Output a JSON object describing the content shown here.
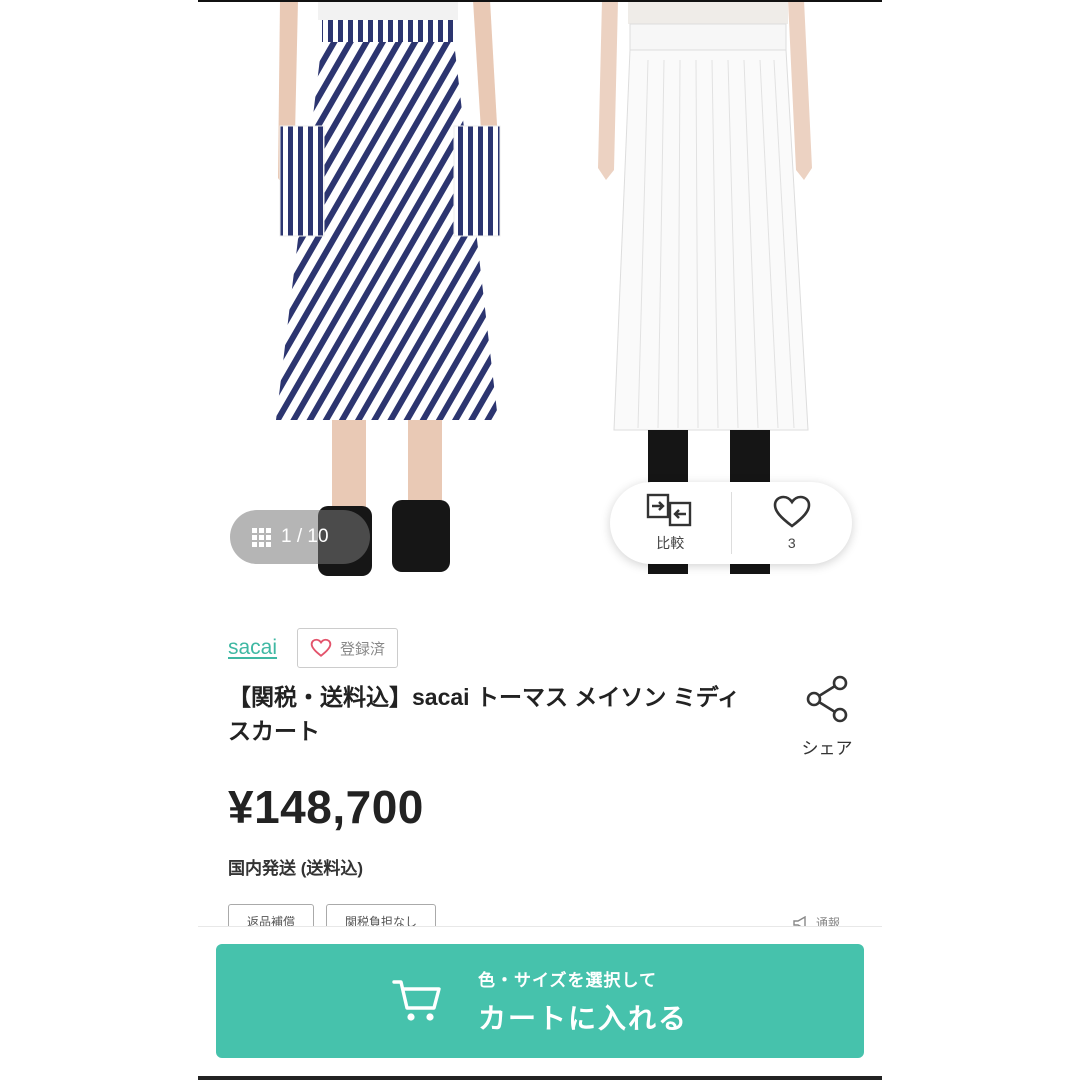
{
  "gallery": {
    "counter": "1 / 10",
    "compare_label": "比較",
    "favorite_count": "3"
  },
  "product": {
    "brand": "sacai",
    "registered_label": "登録済",
    "title": "【関税・送料込】sacai トーマス メイソン ミディ スカート",
    "share_label": "シェア",
    "price": "¥148,700",
    "shipping": "国内発送 (送料込)",
    "tags": [
      "返品補償",
      "関税負担なし"
    ],
    "report_label": "通報"
  },
  "cart": {
    "sub_label": "色・サイズを選択して",
    "main_label": "カートに入れる"
  },
  "colors": {
    "accent": "#46c2ac",
    "brand_link": "#3fb8a3",
    "stripe_navy": "#2c3570"
  }
}
